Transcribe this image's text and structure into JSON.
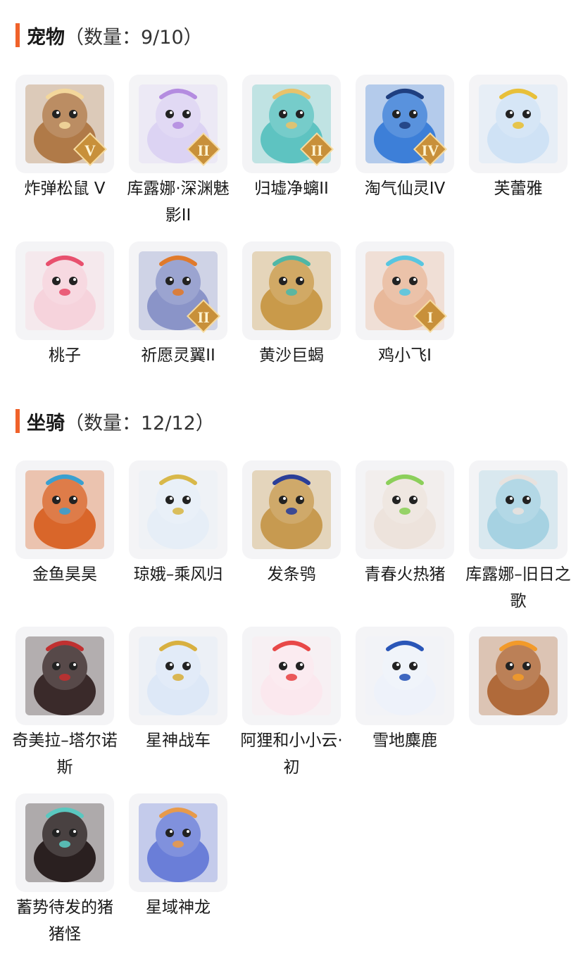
{
  "pets": {
    "title": "宠物",
    "count": "（数量：9/10）",
    "items": [
      {
        "name": "炸弹松鼠 V",
        "icon": "squirrel-icon",
        "bg": "#b07a48",
        "accent": "#f3d79b",
        "badge": "V"
      },
      {
        "name": "库露娜·深渊魅影II",
        "icon": "kuluna-shadow-icon",
        "bg": "#dcd3f3",
        "accent": "#b48ce0",
        "badge": "II"
      },
      {
        "name": "归墟净螭II",
        "icon": "dragon-icon",
        "bg": "#5ec3c1",
        "accent": "#e8c26a",
        "badge": "II"
      },
      {
        "name": "淘气仙灵IV",
        "icon": "blue-dog-icon",
        "bg": "#3d7fd8",
        "accent": "#1f3f80",
        "badge": "IV"
      },
      {
        "name": "芙蕾雅",
        "icon": "freya-icon",
        "bg": "#cfe2f5",
        "accent": "#e8c03a",
        "badge": ""
      },
      {
        "name": "桃子",
        "icon": "pink-cat-icon",
        "bg": "#f6d3dc",
        "accent": "#e8506e",
        "badge": ""
      },
      {
        "name": "祈愿灵翼II",
        "icon": "eagle-icon",
        "bg": "#8a94c8",
        "accent": "#e07a2c",
        "badge": "II"
      },
      {
        "name": "黄沙巨蝎",
        "icon": "scorpion-icon",
        "bg": "#c99a4a",
        "accent": "#4fb7a6",
        "badge": ""
      },
      {
        "name": "鸡小飞I",
        "icon": "chick-icon",
        "bg": "#e8b89a",
        "accent": "#58c6e0",
        "badge": "I"
      }
    ]
  },
  "mounts": {
    "title": "坐骑",
    "count": "（数量：12/12）",
    "items": [
      {
        "name": "金鱼昊昊",
        "icon": "goldfish-icon",
        "bg": "#d9662a",
        "accent": "#3aa0d0",
        "badge": ""
      },
      {
        "name": "琼娥–乘风归",
        "icon": "fairy-icon",
        "bg": "#e6eef7",
        "accent": "#d8b84a",
        "badge": ""
      },
      {
        "name": "发条鸮",
        "icon": "owl-icon",
        "bg": "#c79a50",
        "accent": "#2b3f98",
        "badge": ""
      },
      {
        "name": "青春火热猪",
        "icon": "white-pig-icon",
        "bg": "#ede3dc",
        "accent": "#8ccf5a",
        "badge": ""
      },
      {
        "name": "库露娜–旧日之歌",
        "icon": "kuluna-song-icon",
        "bg": "#a6d2e2",
        "accent": "#e8e2de",
        "badge": ""
      },
      {
        "name": "奇美拉–塔尔诺斯",
        "icon": "chimera-icon",
        "bg": "#3a2a2a",
        "accent": "#c03030",
        "badge": ""
      },
      {
        "name": "星神战车",
        "icon": "pegasus-icon",
        "bg": "#dde8f7",
        "accent": "#d8b040",
        "badge": ""
      },
      {
        "name": "阿狸和小小云·初",
        "icon": "ali-fox-icon",
        "bg": "#fbe8ee",
        "accent": "#e84848",
        "badge": ""
      },
      {
        "name": "雪地麋鹿",
        "icon": "snow-elk-icon",
        "bg": "#eef2fa",
        "accent": "#2a56b8",
        "badge": ""
      },
      {
        "name": "",
        "icon": "capybara-icon",
        "bg": "#b06a3a",
        "accent": "#f29a2a",
        "badge": ""
      },
      {
        "name": "蓄势待发的猪猪怪",
        "icon": "black-pig-icon",
        "bg": "#2a2020",
        "accent": "#5ac8c0",
        "badge": ""
      },
      {
        "name": "星域神龙",
        "icon": "star-dragon-icon",
        "bg": "#6a7ed8",
        "accent": "#e89a4a",
        "badge": ""
      }
    ]
  }
}
